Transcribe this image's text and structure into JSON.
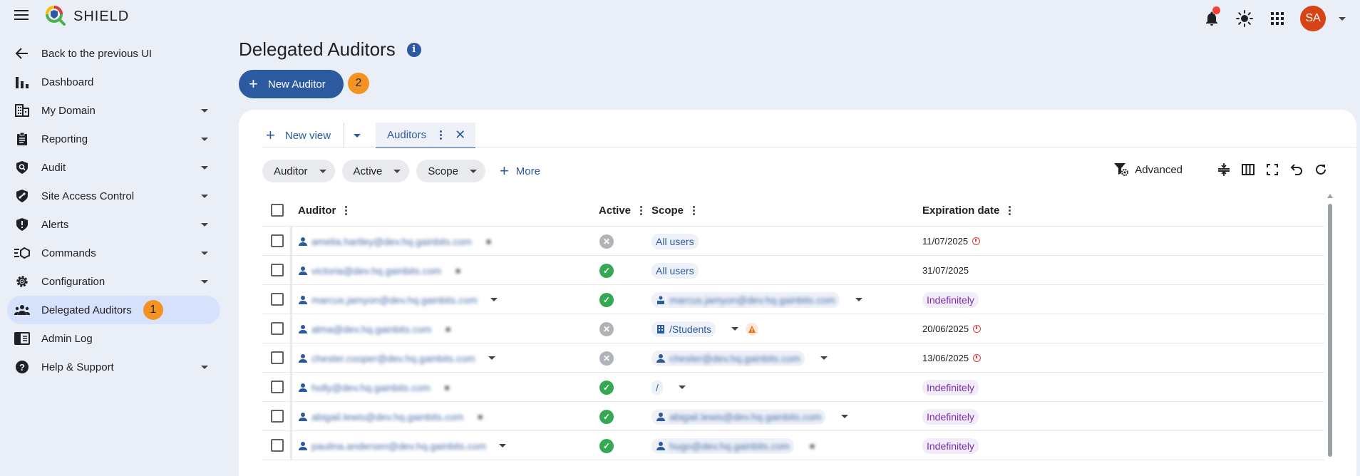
{
  "app": {
    "brand": "SHIELD",
    "avatar_initials": "SA"
  },
  "sidebar": {
    "items": [
      {
        "label": "Back to the previous UI",
        "icon": "arrow-left-icon",
        "has_chevron": false
      },
      {
        "label": "Dashboard",
        "icon": "bar-chart-icon",
        "has_chevron": false
      },
      {
        "label": "My Domain",
        "icon": "building-icon",
        "has_chevron": true
      },
      {
        "label": "Reporting",
        "icon": "clipboard-icon",
        "has_chevron": true
      },
      {
        "label": "Audit",
        "icon": "shield-search-icon",
        "has_chevron": true
      },
      {
        "label": "Site Access Control",
        "icon": "shield-link-icon",
        "has_chevron": true
      },
      {
        "label": "Alerts",
        "icon": "shield-alert-icon",
        "has_chevron": true
      },
      {
        "label": "Commands",
        "icon": "commands-icon",
        "has_chevron": true
      },
      {
        "label": "Configuration",
        "icon": "gear-icon",
        "has_chevron": true
      },
      {
        "label": "Delegated Auditors",
        "icon": "people-icon",
        "has_chevron": false,
        "active": true,
        "badge": "1"
      },
      {
        "label": "Admin Log",
        "icon": "log-icon",
        "has_chevron": false
      },
      {
        "label": "Help & Support",
        "icon": "help-icon",
        "has_chevron": true
      }
    ]
  },
  "page": {
    "title": "Delegated Auditors",
    "info_icon": "i",
    "new_button": "New Auditor",
    "new_button_badge": "2"
  },
  "tabs": {
    "new_view": "New view",
    "active_tab": "Auditors",
    "close": "✕"
  },
  "filters": {
    "chips": [
      "Auditor",
      "Active",
      "Scope"
    ],
    "more": "More",
    "advanced": "Advanced"
  },
  "table": {
    "columns": {
      "auditor": "Auditor",
      "active": "Active",
      "scope": "Scope",
      "expiration": "Expiration date"
    },
    "rows": [
      {
        "auditor": "amelia.hartley@dev.hq.gainbits.com",
        "auditor_extra": "■",
        "has_dd": false,
        "active": false,
        "scope": "All users",
        "scope_type": "plain",
        "expiration": "11/07/2025",
        "exp_type": "date",
        "expiring": true
      },
      {
        "auditor": "victoria@dev.hq.gainbits.com",
        "auditor_extra": "■",
        "has_dd": false,
        "active": true,
        "scope": "All users",
        "scope_type": "plain",
        "expiration": "31/07/2025",
        "exp_type": "date",
        "expiring": false
      },
      {
        "auditor": "marcus.jamyon@dev.hq.gainbits.com",
        "auditor_extra": "",
        "has_dd": true,
        "active": true,
        "scope": "marcus.jamyon@dev.hq.gainbits.com",
        "scope_type": "blur-group",
        "scope_dd": true,
        "expiration": "Indefinitely",
        "exp_type": "indef",
        "expiring": false
      },
      {
        "auditor": "alma@dev.hq.gainbits.com",
        "auditor_extra": "■",
        "has_dd": false,
        "active": false,
        "scope": "/Students",
        "scope_type": "org",
        "scope_dd": true,
        "scope_warn": true,
        "expiration": "20/06/2025",
        "exp_type": "date",
        "expiring": true
      },
      {
        "auditor": "chester.cooper@dev.hq.gainbits.com",
        "auditor_extra": "",
        "has_dd": true,
        "active": false,
        "scope": "chester@dev.hq.gainbits.com",
        "scope_type": "blur-user",
        "scope_dd": true,
        "expiration": "13/06/2025",
        "exp_type": "date",
        "expiring": true
      },
      {
        "auditor": "holly@dev.hq.gainbits.com",
        "auditor_extra": "■",
        "has_dd": false,
        "active": true,
        "scope": "/",
        "scope_type": "plain",
        "scope_dd": true,
        "expiration": "Indefinitely",
        "exp_type": "indef",
        "expiring": false
      },
      {
        "auditor": "abigail.lewis@dev.hq.gainbits.com",
        "auditor_extra": "■",
        "has_dd": false,
        "active": true,
        "scope": "abigail.lewis@dev.hq.gainbits.com",
        "scope_type": "blur-user",
        "scope_dd": true,
        "expiration": "Indefinitely",
        "exp_type": "indef",
        "expiring": false
      },
      {
        "auditor": "paulina.andersen@dev.hq.gainbits.com",
        "auditor_extra": "",
        "has_dd": true,
        "active": true,
        "scope": "hugo@dev.hq.gainbits.com",
        "scope_type": "blur-user",
        "scope_dd": false,
        "scope_extra": "■",
        "expiration": "Indefinitely",
        "exp_type": "indef",
        "expiring": false
      }
    ]
  },
  "colors": {
    "accent": "#2c5aa0",
    "badge": "#f59322",
    "active_green": "#34a853",
    "inactive_grey": "#b0b3b8",
    "indefinite_purple": "#7b2fb0"
  }
}
